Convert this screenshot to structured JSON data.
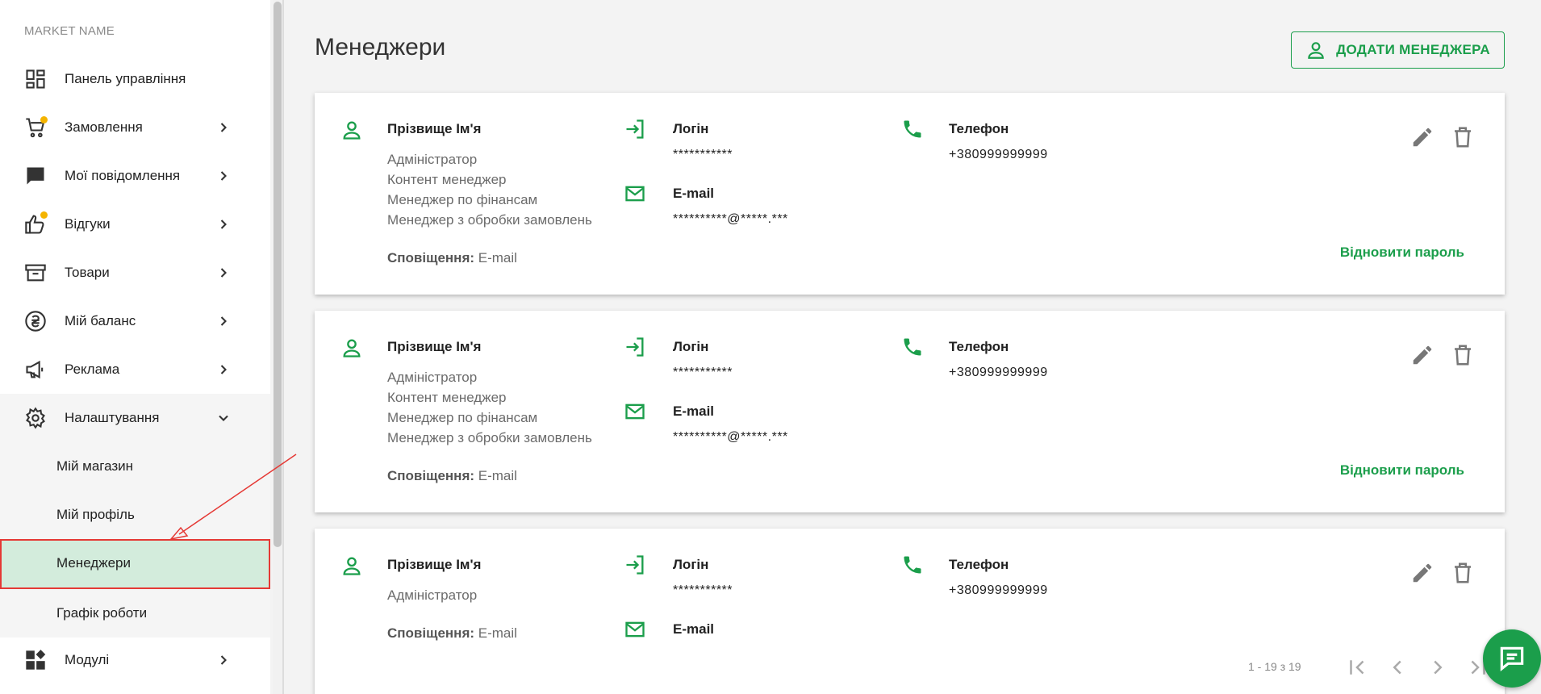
{
  "sidebar": {
    "market_name": "MARKET NAME",
    "items": [
      {
        "label": "Панель управління",
        "icon": "dashboard-icon"
      },
      {
        "label": "Замовлення",
        "icon": "cart-icon",
        "badge": true
      },
      {
        "label": "Мої повідомлення",
        "icon": "message-icon"
      },
      {
        "label": "Відгуки",
        "icon": "thumb-up-icon",
        "badge": true
      },
      {
        "label": "Товари",
        "icon": "archive-icon"
      },
      {
        "label": "Мій баланс",
        "icon": "balance-icon"
      },
      {
        "label": "Реклама",
        "icon": "megaphone-icon"
      },
      {
        "label": "Налаштування",
        "icon": "gear-icon",
        "expanded": true
      },
      {
        "label": "Модулі",
        "icon": "widgets-icon"
      }
    ],
    "sub_items": [
      {
        "label": "Мій магазин"
      },
      {
        "label": "Мій профіль"
      },
      {
        "label": "Менеджери",
        "active": true
      },
      {
        "label": "Графік роботи"
      }
    ]
  },
  "main": {
    "title": "Менеджери",
    "add_button": "ДОДАТИ МЕНЕДЖЕРА",
    "labels": {
      "login": "Логін",
      "email": "E-mail",
      "phone": "Телефон",
      "notifications": "Сповіщення:",
      "reset_password": "Відновити пароль"
    },
    "managers": [
      {
        "name": "Прізвище Ім'я",
        "roles": [
          "Адміністратор",
          "Контент менеджер",
          "Менеджер по фінансам",
          "Менеджер з обробки замовлень"
        ],
        "notifications": "E-mail",
        "login": "***********",
        "email": "**********@*****.***",
        "phone": "+380999999999"
      },
      {
        "name": "Прізвище Ім'я",
        "roles": [
          "Адміністратор",
          "Контент менеджер",
          "Менеджер по фінансам",
          "Менеджер з обробки замовлень"
        ],
        "notifications": "E-mail",
        "login": "***********",
        "email": "**********@*****.***",
        "phone": "+380999999999"
      },
      {
        "name": "Прізвище Ім'я",
        "roles": [
          "Адміністратор"
        ],
        "notifications": "E-mail",
        "login": "***********",
        "phone": "+380999999999"
      }
    ],
    "pagination": "1 - 19 з 19"
  },
  "colors": {
    "accent": "#1b9e4b",
    "active_bg": "#d3ecdc",
    "annotation": "#e53935",
    "badge": "#f4b400"
  }
}
